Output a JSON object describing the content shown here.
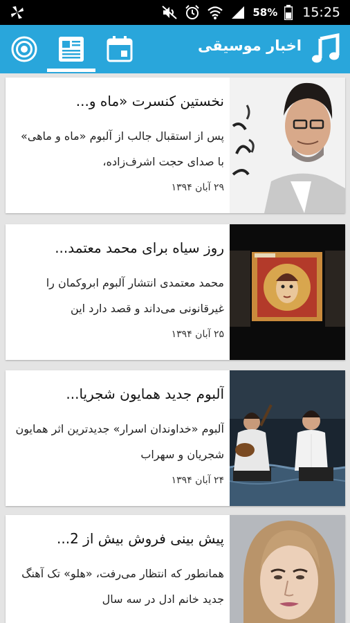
{
  "status_bar": {
    "battery": "58%",
    "time": "15:25"
  },
  "app_bar": {
    "title": "اخبار موسیقی",
    "tabs": [
      {
        "icon": "radio-icon"
      },
      {
        "icon": "newspaper-icon",
        "selected": true
      },
      {
        "icon": "calendar-icon"
      }
    ],
    "colors": {
      "primary": "#29a6db"
    }
  },
  "news": [
    {
      "title": "نخستین کنسرت «ماه و...",
      "summary": "پس از استقبال جالب از آلبوم «ماه و ماهی» با صدای حجت اشرف‌زاده،",
      "date": "۲۹ آبان ۱۳۹۴"
    },
    {
      "title": "روز سیاه برای محمد معتمد...",
      "summary": "محمد معتمدی انتشار آلبوم ابروکمان را غیرقانونی می‌داند و قصد دارد این",
      "date": "۲۵ آبان ۱۳۹۴"
    },
    {
      "title": "آلبوم جدید همایون شجریا...",
      "summary": "آلبوم «خداوندان اسرار» جدیدترین اثر همایون شجریان و سهراب",
      "date": "۲۴ آبان ۱۳۹۴"
    },
    {
      "title": "پیش بینی فروش بیش از 2...",
      "summary": "همانطور که انتظار می‌رفت، «هلو» تک آهنگ جدید خانم ادل در سه سال",
      "date": ""
    }
  ]
}
